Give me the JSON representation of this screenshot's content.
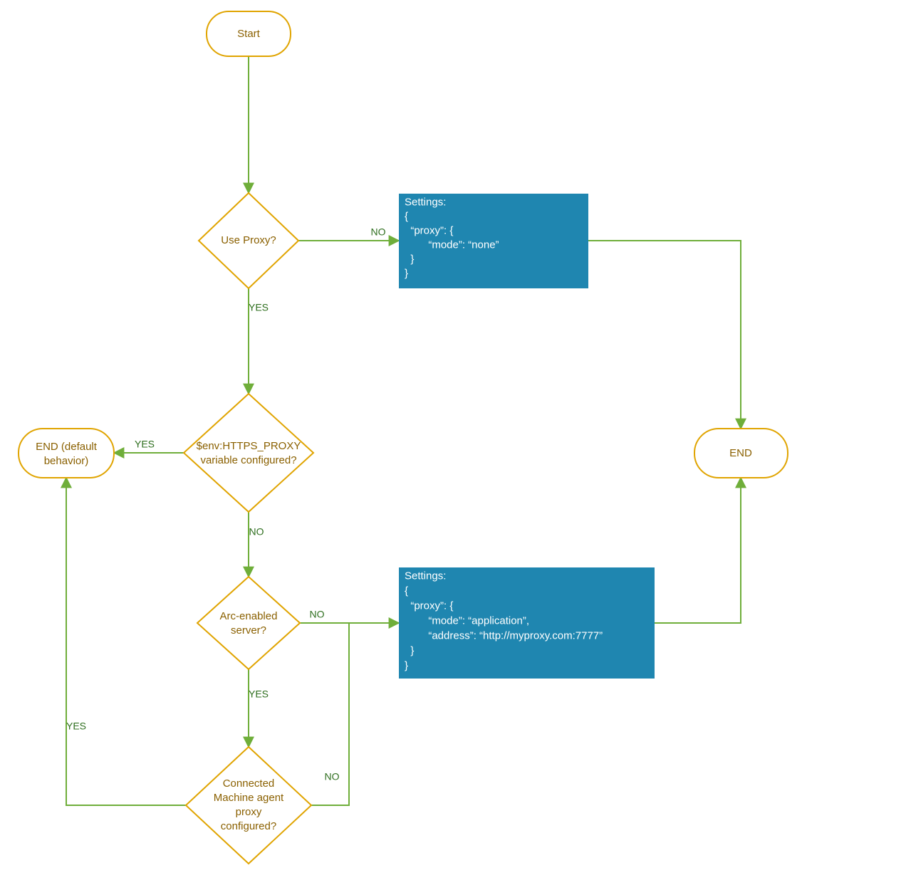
{
  "colors": {
    "node_stroke": "#e0a400",
    "node_fill": "#ffffff",
    "node_text": "#8a6000",
    "edge": "#6fae3a",
    "edge_label": "#2f6f1f",
    "process_fill": "#1f86b0",
    "process_text": "#ffffff"
  },
  "nodes": {
    "start": {
      "label": "Start"
    },
    "use_proxy": {
      "label": "Use Proxy?"
    },
    "env_var": {
      "line1": "$env:HTTPS_PROXY",
      "line2": "variable configured?"
    },
    "arc": {
      "line1": "Arc-enabled",
      "line2": "server?"
    },
    "cm_agent": {
      "line1": "Connected",
      "line2": "Machine agent",
      "line3": "proxy",
      "line4": "configured?"
    },
    "end_default": {
      "line1": "END (default",
      "line2": "behavior)"
    },
    "end": {
      "label": "END"
    }
  },
  "processes": {
    "proxy_none": {
      "lines": [
        "Settings:",
        "{",
        "  “proxy”: {",
        "        “mode”: “none”",
        "  }",
        "}"
      ]
    },
    "proxy_app": {
      "lines": [
        "Settings:",
        "{",
        "  “proxy”: {",
        "        “mode”: “application”,",
        "        “address”: “http://myproxy.com:7777”",
        "  }",
        "}"
      ]
    }
  },
  "edge_labels": {
    "yes": "YES",
    "no": "NO"
  }
}
